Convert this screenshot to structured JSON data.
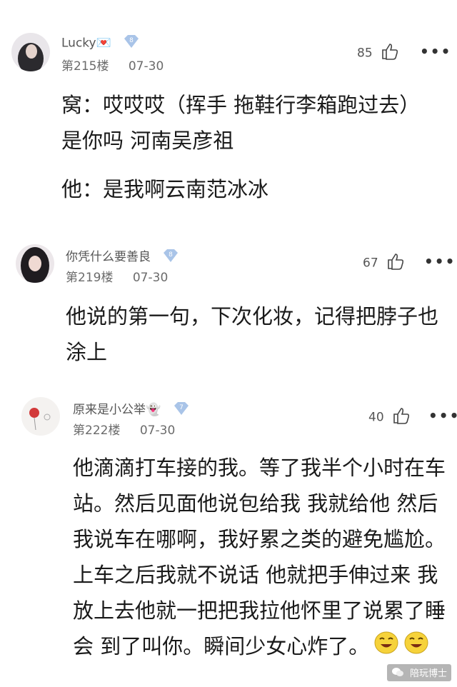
{
  "posts": [
    {
      "username": "Lucky💌",
      "level": "8",
      "floor": "第215楼",
      "date": "07-30",
      "likes": "85",
      "paragraphs": [
        "窝：哎哎哎（挥手 拖鞋行李箱跑过去）是你吗 河南吴彦祖",
        "他：是我啊云南范冰冰"
      ]
    },
    {
      "username": "你凭什么要善良",
      "level": "8",
      "floor": "第219楼",
      "date": "07-30",
      "likes": "67",
      "paragraphs": [
        "他说的第一句，下次化妆，记得把脖子也涂上"
      ]
    },
    {
      "username": "原来是小公举👻",
      "level": "7",
      "floor": "第222楼",
      "date": "07-30",
      "likes": "40",
      "paragraphs": [
        "他滴滴打车接的我。等了我半个小时在车站。然后见面他说包给我 我就给他 然后我说车在哪啊，我好累之类的避免尴尬。上车之后我就不说话 他就把手伸过来 我放上去他就一把把我拉他怀里了说累了睡会 到了叫你。瞬间少女心炸了。"
      ]
    }
  ],
  "watermark": "陪玩博士",
  "colors": {
    "level_badge": "#a9c4e8",
    "text": "#1a1a1a",
    "meta": "#6b6b6b"
  }
}
